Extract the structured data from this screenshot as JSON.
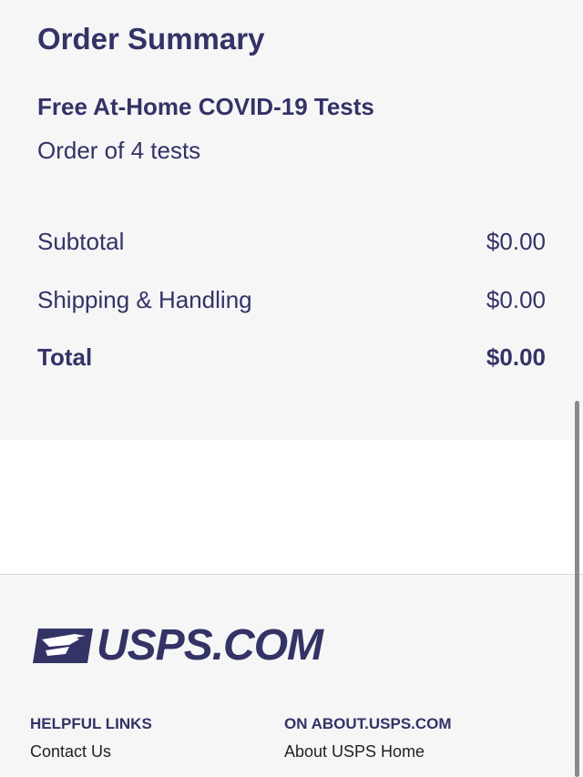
{
  "summary": {
    "title": "Order Summary",
    "product": "Free At-Home COVID-19 Tests",
    "quantity": "Order of 4 tests",
    "rows": [
      {
        "label": "Subtotal",
        "value": "$0.00"
      },
      {
        "label": "Shipping & Handling",
        "value": "$0.00"
      },
      {
        "label": "Total",
        "value": "$0.00"
      }
    ]
  },
  "footer": {
    "logo_text": "USPS.COM",
    "helpful_links": {
      "heading": "HELPFUL LINKS",
      "links": [
        "Contact Us"
      ]
    },
    "about": {
      "heading": "ON ABOUT.USPS.COM",
      "links": [
        "About USPS Home"
      ]
    }
  },
  "colors": {
    "brand": "#333366",
    "panel": "#f6f6f7"
  }
}
